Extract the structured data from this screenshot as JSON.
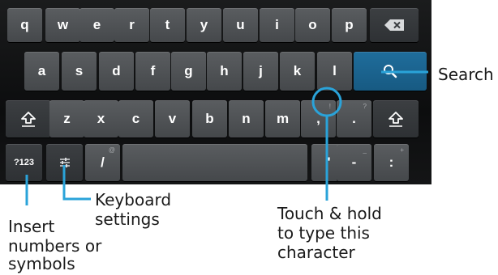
{
  "keyboard": {
    "row1": [
      "q",
      "w",
      "e",
      "r",
      "t",
      "y",
      "u",
      "i",
      "o",
      "p"
    ],
    "row2": [
      "a",
      "s",
      "d",
      "f",
      "g",
      "h",
      "j",
      "k",
      "l"
    ],
    "row3": [
      "z",
      "x",
      "c",
      "v",
      "b",
      "n",
      "m",
      ",",
      "."
    ],
    "row3_hints": [
      "!",
      "?"
    ],
    "numbers_key": "?123",
    "slash_key": "/",
    "apostrophe_key": "'",
    "dash_key": "-",
    "colon_key": ":",
    "hints": {
      "slash": "@",
      "dash": "_",
      "colon": "+"
    },
    "icons": {
      "backspace": "backspace-icon",
      "search": "search-icon",
      "shift": "shift-icon",
      "settings": "settings-sliders-icon"
    },
    "accent_color": "#1f6d9c"
  },
  "callouts": {
    "search": "Search",
    "keyboard_settings": [
      "Keyboard",
      "settings"
    ],
    "insert_numbers": [
      "Insert",
      "numbers or",
      "symbols"
    ],
    "touch_hold": [
      "Touch & hold",
      "to type this",
      "character"
    ],
    "line_color": "#2aa3d9"
  }
}
